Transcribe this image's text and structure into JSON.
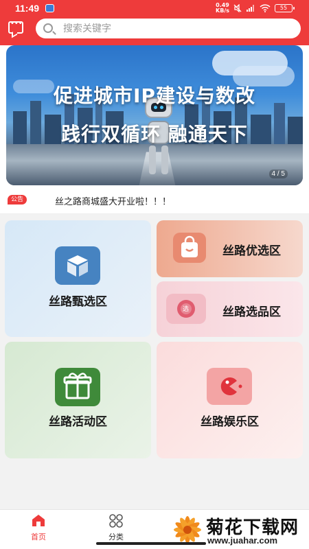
{
  "status_bar": {
    "time": "11:49",
    "network_speed": "0.49\nKB/s",
    "battery": "55"
  },
  "search": {
    "placeholder": "搜索关键字"
  },
  "banner": {
    "line1": "促进城市IP建设与数改",
    "line2": "践行双循环  融通天下",
    "indicator": "4 / 5"
  },
  "notice": {
    "tag": "公告",
    "text": "丝之路商城盛大开业啦！！！"
  },
  "zones": [
    {
      "label": "丝路甄选区",
      "icon": "box-icon",
      "color": "#4683c1"
    },
    {
      "label": "丝路优选区",
      "icon": "shopping-bag-icon",
      "color": "#e88a70"
    },
    {
      "label": "丝路选品区",
      "icon": "select-badge-icon",
      "badge_text": "选",
      "color": "#f2bcc5"
    },
    {
      "label": "丝路活动区",
      "icon": "gift-icon",
      "color": "#3f8a3a"
    },
    {
      "label": "丝路娱乐区",
      "icon": "game-face-icon",
      "color": "#f3a4a4"
    }
  ],
  "bottom_nav": [
    {
      "label": "首页",
      "icon": "home-icon",
      "active": true
    },
    {
      "label": "分类",
      "icon": "category-icon",
      "active": false
    }
  ],
  "watermark": {
    "title": "菊花下载网",
    "url": "www.juahar.com"
  },
  "colors": {
    "brand_red": "#ee3b3b"
  }
}
